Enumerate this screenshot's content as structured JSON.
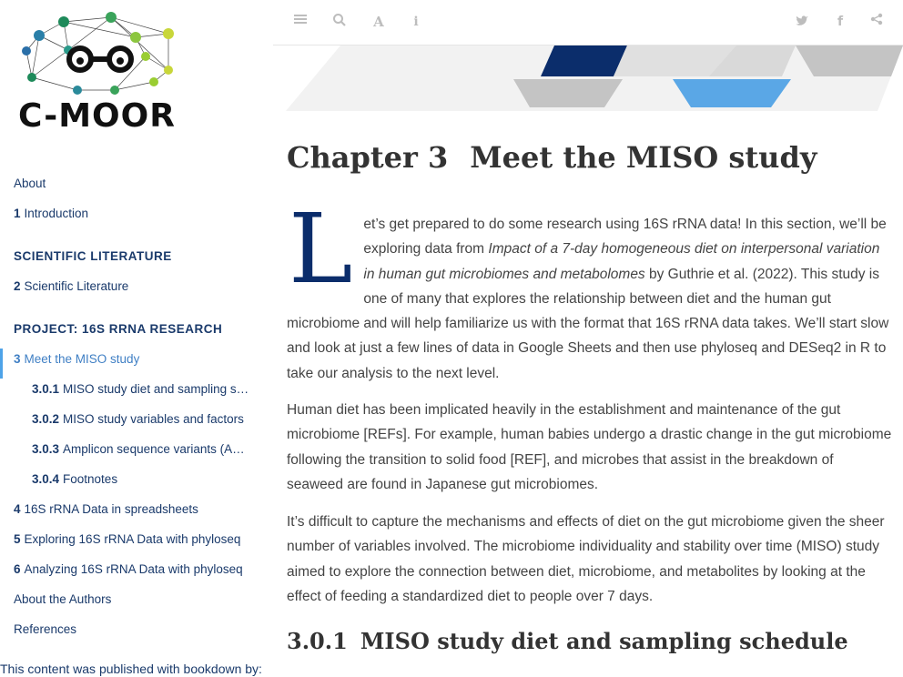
{
  "brand": {
    "name": "C-MOOR"
  },
  "toc": {
    "items": [
      {
        "kind": "item",
        "num": "",
        "label": "About",
        "level": 0,
        "active": false
      },
      {
        "kind": "item",
        "num": "1",
        "label": "Introduction",
        "level": 0,
        "active": false
      },
      {
        "kind": "part",
        "label": "SCIENTIFIC LITERATURE"
      },
      {
        "kind": "item",
        "num": "2",
        "label": "Scientific Literature",
        "level": 0,
        "active": false
      },
      {
        "kind": "part",
        "label": "PROJECT: 16S RRNA RESEARCH"
      },
      {
        "kind": "item",
        "num": "3",
        "label": "Meet the MISO study",
        "level": 0,
        "active": true
      },
      {
        "kind": "item",
        "num": "3.0.1",
        "label": "MISO study diet and sampling s…",
        "level": 1,
        "active": false
      },
      {
        "kind": "item",
        "num": "3.0.2",
        "label": "MISO study variables and factors",
        "level": 1,
        "active": false
      },
      {
        "kind": "item",
        "num": "3.0.3",
        "label": "Amplicon sequence variants (A…",
        "level": 1,
        "active": false
      },
      {
        "kind": "item",
        "num": "3.0.4",
        "label": "Footnotes",
        "level": 1,
        "active": false
      },
      {
        "kind": "item",
        "num": "4",
        "label": "16S rRNA Data in spreadsheets",
        "level": 0,
        "active": false
      },
      {
        "kind": "item",
        "num": "5",
        "label": "Exploring 16S rRNA Data with phyloseq",
        "level": 0,
        "active": false
      },
      {
        "kind": "item",
        "num": "6",
        "label": "Analyzing 16S rRNA Data with phyloseq",
        "level": 0,
        "active": false
      },
      {
        "kind": "item",
        "num": "",
        "label": "About the Authors",
        "level": 0,
        "active": false
      },
      {
        "kind": "item",
        "num": "",
        "label": "References",
        "level": 0,
        "active": false
      }
    ],
    "footer": "This content was published with bookdown by:"
  },
  "toolbar": {
    "left_icons": [
      "toc-toggle-icon",
      "search-icon",
      "font-settings-icon",
      "info-icon"
    ],
    "right_icons": [
      "twitter-icon",
      "facebook-icon",
      "share-icon"
    ]
  },
  "content": {
    "chapter_num": "Chapter 3",
    "chapter_title": "Meet the MISO study",
    "dropcap": "L",
    "p1_a": "et’s get prepared to do some research using 16S rRNA data! In this section, we’ll be exploring data from ",
    "p1_em": "Impact of a 7-day homogeneous diet on interpersonal variation in human gut microbiomes and metabolomes",
    "p1_b": " by Guthrie et al. (2022). This study is one of many that explores the relationship between diet and the human gut microbiome and will help familiarize us with the format that 16S rRNA data takes. We’ll start slow and look at just a few lines of data in Google Sheets and then use phyloseq and DESeq2 in R to take our analysis to the next level.",
    "p2": "Human diet has been implicated heavily in the establishment and maintenance of the gut microbiome [REFs]. For example, human babies undergo a drastic change in the gut microbiome following the transition to solid food [REF], and microbes that assist in the breakdown of seaweed are found in Japanese gut microbiomes.",
    "p3": "It’s difficult to capture the mechanisms and effects of diet on the gut microbiome given the sheer number of variables involved. The microbiome individuality and stability over time (MISO) study aimed to explore the connection between diet, microbiome, and metabolites by looking at the effect of feeding a standardized diet to people over 7 days.",
    "section_num": "3.0.1",
    "section_title": "MISO study diet and sampling schedule"
  },
  "colors": {
    "link": "#1a3a6b",
    "active": "#3f7fc4",
    "accent_navy": "#0b2d6b",
    "accent_blue": "#5aa7e6",
    "icon_gray": "#bdbdbd"
  }
}
